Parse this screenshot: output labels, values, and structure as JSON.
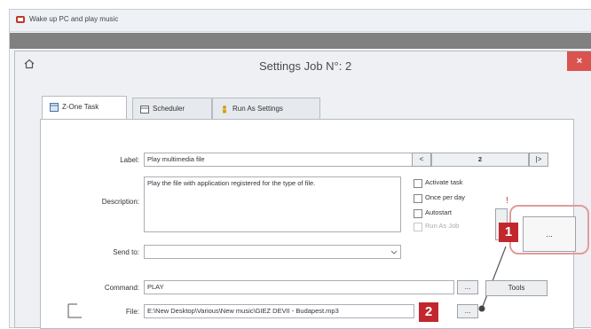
{
  "outer_window": {
    "title": "Wake up PC and play music"
  },
  "dialog": {
    "title": "Settings Job N°: 2",
    "close_label": "×"
  },
  "tabs": [
    {
      "label": "Z-One Task",
      "active": true
    },
    {
      "label": "Scheduler",
      "active": false
    },
    {
      "label": "Run As Settings",
      "active": false
    }
  ],
  "form": {
    "label_caption": "Label:",
    "label_value": "Play multimedia file",
    "description_caption": "Description:",
    "description_value": "Play the file with application registered for the type of file.",
    "sendto_caption": "Send to:",
    "sendto_value": "",
    "nav_prev": "<",
    "nav_number": "2",
    "nav_next": "|>",
    "checkboxes": [
      {
        "label": "Activate task",
        "checked": false,
        "enabled": true
      },
      {
        "label": "Once per day",
        "checked": false,
        "enabled": true
      },
      {
        "label": "Autostart",
        "checked": false,
        "enabled": true
      },
      {
        "label": "Run As Job",
        "checked": false,
        "enabled": false
      }
    ],
    "command_caption": "Command:",
    "command_value": "PLAY",
    "file_caption": "File:",
    "file_value": "E:\\New Desktop\\Various\\New music\\GIEZ DEVII - Budapest.mp3",
    "ellipsis_small": "...",
    "ellipsis_big": "...",
    "tools_label": "Tools"
  },
  "callouts": [
    "1",
    "2"
  ],
  "colors": {
    "callout": "#c1272d",
    "close": "#d9534f"
  }
}
